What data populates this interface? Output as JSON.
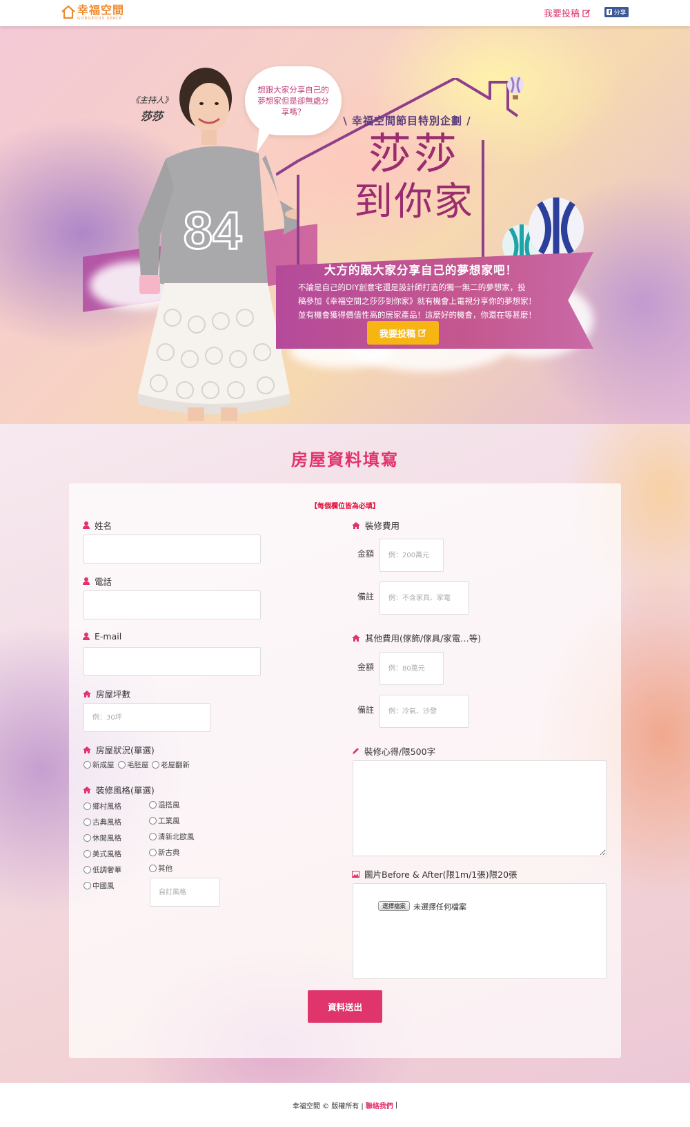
{
  "nav": {
    "logo_text": "幸福空間",
    "logo_subtitle": "Gorgeous Space",
    "submit_link": "我要投稿",
    "share_label": "分享"
  },
  "hero": {
    "host_role": "《主持人》",
    "host_name": "莎莎",
    "bubble_text": "想跟大家分享自己的夢想家但是卻無處分享嗎？",
    "subtitle": "\\ 幸福空間節目特別企劃 /",
    "title_line1": "莎莎",
    "title_line2": "到你家",
    "tagline": "大方的跟大家分享自己的夢想家吧！",
    "description_lines": [
      "不論是自己的DIY創意宅還是設計師打造的獨一無二的夢想家，投",
      "稿參加《幸福空間之莎莎到你家》就有機會上電視分享你的夢想家！",
      "並有機會獲得價值性高的居家產品！這麼好的機會，你還在等甚麼！"
    ],
    "cta_label": "我要投稿",
    "shirt_number": "84"
  },
  "form": {
    "section_title": "房屋資料填寫",
    "required_note": "【每個欄位皆為必填】",
    "name": {
      "label": "姓名",
      "value": ""
    },
    "phone": {
      "label": "電話",
      "value": ""
    },
    "email": {
      "label": "E-mail",
      "value": ""
    },
    "area": {
      "label": "房屋坪數",
      "placeholder": "例：30坪"
    },
    "condition": {
      "label": "房屋狀況(單選)",
      "options": [
        "新成屋",
        "毛胚屋",
        "老屋翻新"
      ]
    },
    "style": {
      "label": "裝修風格(單選)",
      "options_col1": [
        "鄉村風格",
        "古典風格",
        "休閒風格",
        "美式風格",
        "低調奢華",
        "中國風"
      ],
      "options_col2": [
        "混搭風",
        "工業風",
        "清新北歐風",
        "新古典",
        "其他"
      ],
      "custom_placeholder": "自訂風格"
    },
    "renovation_cost": {
      "label": "裝修費用",
      "amount_label": "金額",
      "amount_placeholder": "例：200萬元",
      "note_label": "備註",
      "note_placeholder": "例：不含家具、家電"
    },
    "other_cost": {
      "label": "其他費用(傢飾/傢具/家電…等)",
      "amount_label": "金額",
      "amount_placeholder": "例：80萬元",
      "note_label": "備註",
      "note_placeholder": "例：冷氣、沙發"
    },
    "experience": {
      "label": "裝修心得/限500字",
      "value": ""
    },
    "photos": {
      "label": "圖片Before & After(限1m/1張)限20張",
      "file_button": "選擇檔案",
      "file_status": "未選擇任何檔案"
    },
    "submit_label": "資料送出"
  },
  "footer": {
    "copyright": "幸福空間 © 版權所有 |",
    "contact_link": "聯絡我們",
    "trailing": "|"
  },
  "colors": {
    "accent": "#e0346c",
    "logo": "#f08a2e",
    "cta": "#f7b513",
    "ribbon": "#b54a9a",
    "facebook": "#3b5998"
  }
}
